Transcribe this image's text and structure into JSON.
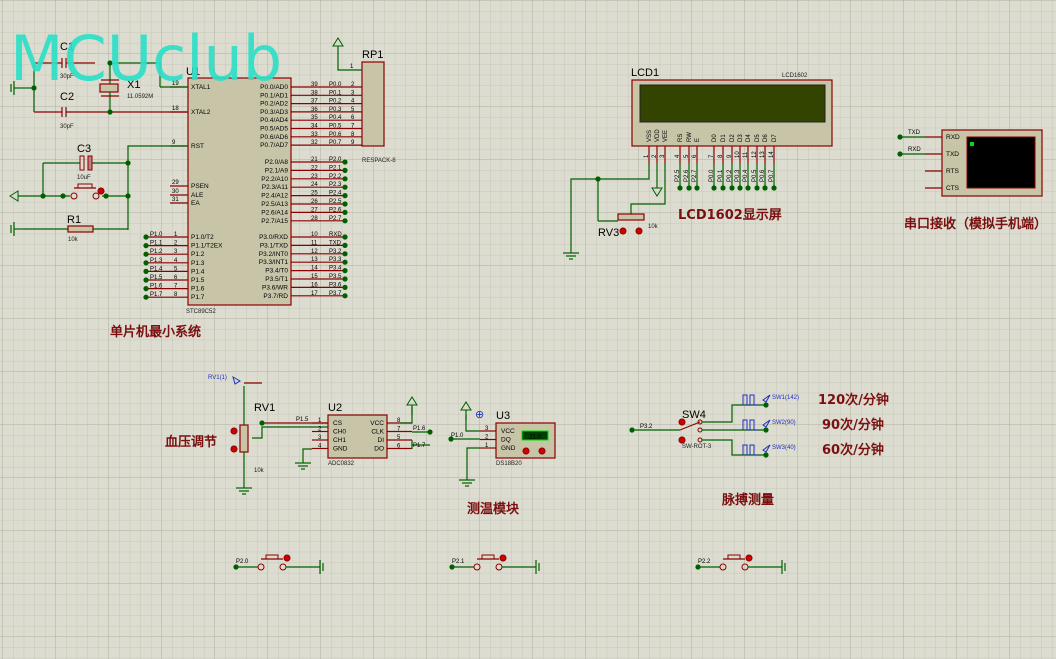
{
  "watermark": "MCUclub",
  "colors": {
    "wire": "#006000",
    "pin": "#8b0000",
    "body": "#c8c4a8",
    "title_text": "#7a1010",
    "lcd_screen": "#334400",
    "probe": "#2030c0"
  },
  "u1": {
    "ref": "U1",
    "part": "STC89C52",
    "left_top": [
      {
        "num": "19",
        "name": "XTAL1"
      },
      {
        "num": "18",
        "name": "XTAL2"
      },
      {
        "num": "9",
        "name": "RST"
      },
      {
        "num": "29",
        "name": "PSEN"
      },
      {
        "num": "30",
        "name": "ALE"
      },
      {
        "num": "31",
        "name": "EA"
      }
    ],
    "left_p1": [
      {
        "num": "1",
        "name": "P1.0/T2",
        "net": "P1.0"
      },
      {
        "num": "2",
        "name": "P1.1/T2EX",
        "net": "P1.1"
      },
      {
        "num": "3",
        "name": "P1.2",
        "net": "P1.2"
      },
      {
        "num": "4",
        "name": "P1.3",
        "net": "P1.3"
      },
      {
        "num": "5",
        "name": "P1.4",
        "net": "P1.4"
      },
      {
        "num": "6",
        "name": "P1.5",
        "net": "P1.5"
      },
      {
        "num": "7",
        "name": "P1.6",
        "net": "P1.6"
      },
      {
        "num": "8",
        "name": "P1.7",
        "net": "P1.7"
      }
    ],
    "right_p0": [
      {
        "num": "39",
        "name": "P0.0/AD0",
        "net": "P0.0",
        "rp": "2"
      },
      {
        "num": "38",
        "name": "P0.1/AD1",
        "net": "P0.1",
        "rp": "3"
      },
      {
        "num": "37",
        "name": "P0.2/AD2",
        "net": "P0.2",
        "rp": "4"
      },
      {
        "num": "36",
        "name": "P0.3/AD3",
        "net": "P0.3",
        "rp": "5"
      },
      {
        "num": "35",
        "name": "P0.4/AD4",
        "net": "P0.4",
        "rp": "6"
      },
      {
        "num": "34",
        "name": "P0.5/AD5",
        "net": "P0.5",
        "rp": "7"
      },
      {
        "num": "33",
        "name": "P0.6/AD6",
        "net": "P0.6",
        "rp": "8"
      },
      {
        "num": "32",
        "name": "P0.7/AD7",
        "net": "P0.7",
        "rp": "9"
      }
    ],
    "right_p2": [
      {
        "num": "21",
        "name": "P2.0/A8",
        "net": "P2.0"
      },
      {
        "num": "22",
        "name": "P2.1/A9",
        "net": "P2.1"
      },
      {
        "num": "23",
        "name": "P2.2/A10",
        "net": "P2.2"
      },
      {
        "num": "24",
        "name": "P2.3/A11",
        "net": "P2.3"
      },
      {
        "num": "25",
        "name": "P2.4/A12",
        "net": "P2.4"
      },
      {
        "num": "26",
        "name": "P2.5/A13",
        "net": "P2.5"
      },
      {
        "num": "27",
        "name": "P2.6/A14",
        "net": "P2.6"
      },
      {
        "num": "28",
        "name": "P2.7/A15",
        "net": "P2.7"
      }
    ],
    "right_p3": [
      {
        "num": "10",
        "name": "P3.0/RXD",
        "net": "RXD"
      },
      {
        "num": "11",
        "name": "P3.1/TXD",
        "net": "TXD"
      },
      {
        "num": "12",
        "name": "P3.2/INT0",
        "net": "P3.2"
      },
      {
        "num": "13",
        "name": "P3.3/INT1",
        "net": "P3.3"
      },
      {
        "num": "14",
        "name": "P3.4/T0",
        "net": "P3.4"
      },
      {
        "num": "15",
        "name": "P3.5/T1",
        "net": "P3.5"
      },
      {
        "num": "16",
        "name": "P3.6/WR",
        "net": "P3.6"
      },
      {
        "num": "17",
        "name": "P3.7/RD",
        "net": "P3.7"
      }
    ]
  },
  "rp1": {
    "ref": "RP1",
    "part": "RESPACK-8",
    "pin1": "1"
  },
  "c1": {
    "ref": "C1",
    "value": "30pF"
  },
  "c2": {
    "ref": "C2",
    "value": "30pF"
  },
  "c3": {
    "ref": "C3",
    "value": "10uF"
  },
  "x1": {
    "ref": "X1",
    "value": "11.0592M"
  },
  "r1": {
    "ref": "R1",
    "value": "10k"
  },
  "lcd": {
    "ref": "LCD1",
    "part": "LCD1602",
    "pins": [
      {
        "name": "VSS",
        "num": "1",
        "net": ""
      },
      {
        "name": "VDD",
        "num": "2",
        "net": ""
      },
      {
        "name": "VEE",
        "num": "3",
        "net": ""
      },
      {
        "name": "RS",
        "num": "4",
        "net": "P2.5"
      },
      {
        "name": "RW",
        "num": "5",
        "net": "P2.6"
      },
      {
        "name": "E",
        "num": "6",
        "net": "P2.7"
      },
      {
        "name": "D0",
        "num": "7",
        "net": "P0.0"
      },
      {
        "name": "D1",
        "num": "8",
        "net": "P0.1"
      },
      {
        "name": "D2",
        "num": "9",
        "net": "P0.2"
      },
      {
        "name": "D3",
        "num": "10",
        "net": "P0.3"
      },
      {
        "name": "D4",
        "num": "11",
        "net": "P0.4"
      },
      {
        "name": "D5",
        "num": "12",
        "net": "P0.5"
      },
      {
        "name": "D6",
        "num": "13",
        "net": "P0.6"
      },
      {
        "name": "D7",
        "num": "14",
        "net": "P0.7"
      }
    ]
  },
  "rv3": {
    "ref": "RV3",
    "value": "10k"
  },
  "terminal": {
    "pins": [
      "RXD",
      "TXD",
      "RTS",
      "CTS"
    ],
    "nets": [
      "TXD",
      "RXD"
    ]
  },
  "rv1": {
    "ref": "RV1",
    "value": "10k",
    "probe": "RV1(1)",
    "net": "P1.5"
  },
  "u2": {
    "ref": "U2",
    "part": "ADC0832",
    "left": [
      {
        "num": "1",
        "name": "CS"
      },
      {
        "num": "2",
        "name": "CH0"
      },
      {
        "num": "3",
        "name": "CH1"
      },
      {
        "num": "4",
        "name": "GND"
      }
    ],
    "right": [
      {
        "num": "8",
        "name": "VCC"
      },
      {
        "num": "7",
        "name": "CLK"
      },
      {
        "num": "5",
        "name": "DI"
      },
      {
        "num": "6",
        "name": "DO"
      }
    ],
    "nets": [
      "P1.6",
      "P1.7"
    ]
  },
  "u3": {
    "ref": "U3",
    "part": "DS18B20",
    "reading": "21.0",
    "net": "P1.0",
    "pins": [
      {
        "num": "3",
        "name": "VCC"
      },
      {
        "num": "2",
        "name": "DQ"
      },
      {
        "num": "1",
        "name": "GND"
      }
    ]
  },
  "sw4": {
    "ref": "SW4",
    "part": "SW-ROT-3",
    "net": "P3.2"
  },
  "generators": [
    {
      "label": "SW1(142)",
      "rate": "120次/分钟"
    },
    {
      "label": "SW2(90)",
      "rate": "90次/分钟"
    },
    {
      "label": "SW3(40)",
      "rate": "60次/分钟"
    }
  ],
  "buttons": [
    {
      "net": "P2.0"
    },
    {
      "net": "P2.1"
    },
    {
      "net": "P2.2"
    }
  ],
  "titles": {
    "mcu": "单片机最小系统",
    "bp": "血压调节",
    "temp": "测温模块",
    "lcd": "LCD1602显示屏",
    "serial": "串口接收（模拟手机端）",
    "pulse": "脉搏测量"
  }
}
